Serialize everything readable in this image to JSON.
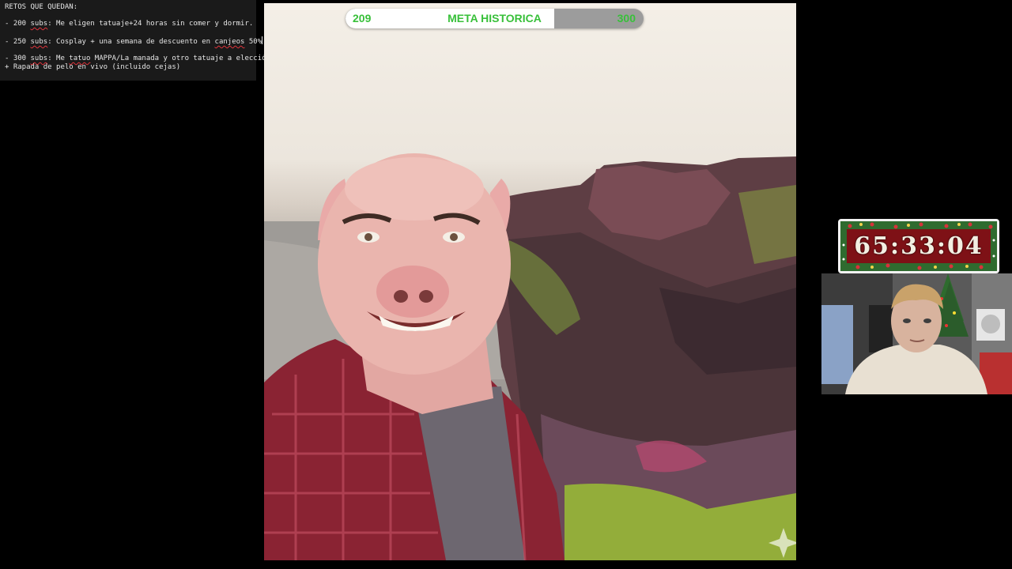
{
  "notes": {
    "title": "RETOS QUE QUEDAN:",
    "items": [
      {
        "prefix": "- 200 ",
        "word": "subs",
        "text": ": Me eligen tatuaje+24 horas sin comer y dormir."
      },
      {
        "prefix": "- 250 ",
        "word": "subs",
        "text": ": Cosplay + una semana de descuento en ",
        "word2": "canjeos",
        "text2": " 50%"
      },
      {
        "prefix": "- 300 ",
        "word": "subs",
        "text": ": Me ",
        "word2": "tatuo",
        "text2": " MAPPA/La manada y otro tatuaje a elección",
        "line2": "+ Rapada de pelo en vivo (incluido cejas)"
      }
    ]
  },
  "progress": {
    "current": "209",
    "label": "META HISTORICA",
    "goal": "300",
    "fraction": 0.7,
    "color": "#38c03a"
  },
  "timer": {
    "value": "65:33:04",
    "theme": "christmas-garland"
  },
  "main_image": {
    "icon": "sparkle-watermark-icon"
  },
  "webcam": {
    "icon": "webcam-feed"
  }
}
